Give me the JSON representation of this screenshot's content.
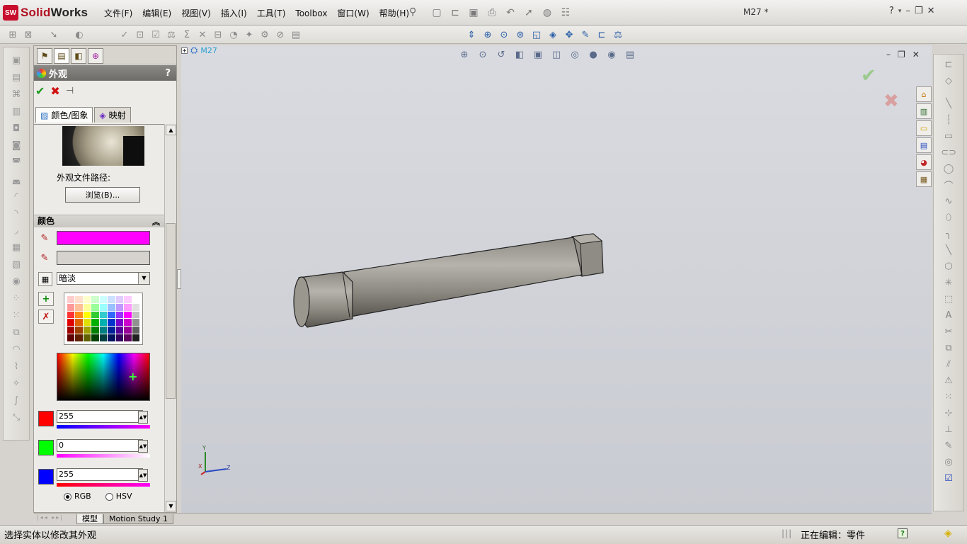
{
  "app": {
    "name_prefix": "Solid",
    "name_suffix": "Works",
    "logo_text": "SW",
    "doc_title": "M27 *"
  },
  "menu": [
    "文件(F)",
    "编辑(E)",
    "视图(V)",
    "插入(I)",
    "工具(T)",
    "Toolbox",
    "窗口(W)",
    "帮助(H)"
  ],
  "window_controls": {
    "help": "?",
    "minimize": "–",
    "restore": "❐",
    "close": "✕"
  },
  "property_manager": {
    "title": "外观",
    "help": "?",
    "ok": "✔",
    "cancel": "✖",
    "pin": "⊣",
    "tabs": [
      {
        "label": "颜色/图象",
        "icon": "image-icon"
      },
      {
        "label": "映射",
        "icon": "mapping-icon"
      }
    ],
    "file_path_label": "外观文件路径:",
    "browse_label": "浏览(B)...",
    "color_section": "颜色",
    "primary_color": "#ff00ff",
    "secondary_color": "#d6d3ce",
    "lighting_option": "暗淡",
    "rgb": {
      "r": "255",
      "g": "0",
      "b": "255"
    },
    "mode_rgb": "RGB",
    "mode_hsv": "HSV",
    "palette": [
      [
        "#ffcccc",
        "#ffe0cc",
        "#ffffcc",
        "#ccffcc",
        "#ccffff",
        "#cce0ff",
        "#e0ccff",
        "#ffccff",
        "#ffffff"
      ],
      [
        "#ff9999",
        "#ffc099",
        "#ffff99",
        "#99ff99",
        "#99ffff",
        "#99c0ff",
        "#c099ff",
        "#ff99ff",
        "#e0e0e0"
      ],
      [
        "#ff3333",
        "#ff8c1a",
        "#ffff00",
        "#33cc33",
        "#33cccc",
        "#3366ff",
        "#9933ff",
        "#ff00ff",
        "#c0c0c0"
      ],
      [
        "#e00000",
        "#e06000",
        "#e0e000",
        "#00b000",
        "#00b0b0",
        "#0033cc",
        "#7700cc",
        "#cc00cc",
        "#909090"
      ],
      [
        "#a00000",
        "#a04000",
        "#a0a000",
        "#008000",
        "#008080",
        "#002299",
        "#550099",
        "#990099",
        "#606060"
      ],
      [
        "#600000",
        "#602000",
        "#606000",
        "#004000",
        "#004040",
        "#001160",
        "#330060",
        "#600060",
        "#202020"
      ]
    ]
  },
  "graphics": {
    "tree_label": "M27",
    "axes": {
      "x": "X",
      "y": "Y",
      "z": "Z"
    }
  },
  "bottom_tabs": [
    "模型",
    "Motion Study 1"
  ],
  "status": {
    "message": "选择实体以修改其外观",
    "editing": "正在编辑：零件",
    "help_icon": "?"
  }
}
